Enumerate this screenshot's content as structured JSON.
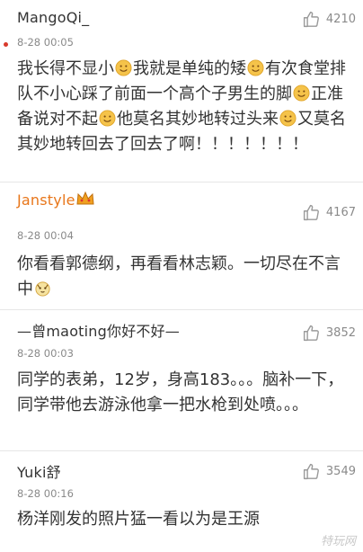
{
  "comments": [
    {
      "user": "MangoQi_",
      "time": "8-28 00:05",
      "likes": "4210",
      "segments": [
        "我长得不显小",
        "我就是单纯的矮",
        "有次食堂排队不小心踩了前面一个高个子男生的脚",
        "正准备说对不起",
        "他莫名其妙地转过头来",
        "又莫名其妙地转回去了回去了啊！！！！！！！"
      ]
    },
    {
      "user": "Janstyle",
      "time": "8-28 00:04",
      "likes": "4167",
      "text": "你看看郭德纲，再看看林志颖。一切尽在不言中"
    },
    {
      "user": "—曾maoting你好不好—",
      "time": "8-28 00:03",
      "likes": "3852",
      "text": "同学的表弟，12岁，身高183。。。脑补一下，同学带他去游泳他拿一把水枪到处喷。。。"
    },
    {
      "user": "Yuki舒",
      "time": "8-28 00:16",
      "likes": "3549",
      "text": "杨洋刚发的照片猛一看以为是王源"
    }
  ],
  "watermark": "特玩网",
  "colors": {
    "username_highlight": "#e8761a",
    "text": "#333333",
    "meta": "#8a8a8a"
  },
  "icons": [
    "thumb-up-icon",
    "smile-emoji-icon",
    "crown-icon",
    "cute-emoji-icon"
  ]
}
